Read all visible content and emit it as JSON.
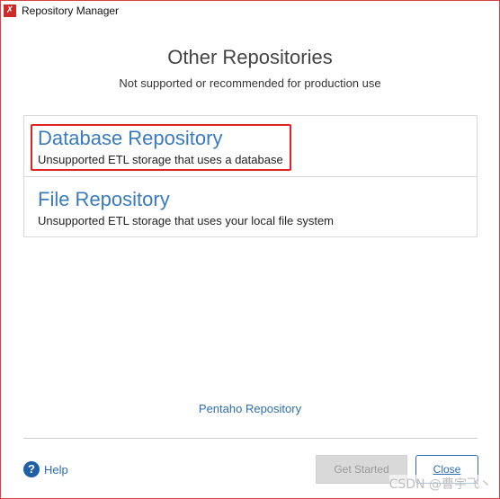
{
  "window": {
    "title": "Repository Manager",
    "app_icon": "pentaho-app-icon",
    "app_icon_glyph": "✗"
  },
  "heading": "Other Repositories",
  "subheading": "Not supported or recommended for production use",
  "repositories": [
    {
      "name": "Database Repository",
      "description": "Unsupported ETL storage that uses a database",
      "highlighted": true
    },
    {
      "name": "File Repository",
      "description": "Unsupported ETL storage that uses your local file system",
      "highlighted": false
    }
  ],
  "pentaho_link": "Pentaho Repository",
  "help": {
    "icon": "help-icon",
    "icon_glyph": "?",
    "label": "Help"
  },
  "buttons": {
    "get_started": "Get Started",
    "close": "Close"
  },
  "watermark": "CSDN @曹宇飞丶",
  "colors": {
    "accent_blue": "#3a7bbf",
    "highlight_red": "#e02222",
    "disabled_gray": "#d9d9d9"
  }
}
